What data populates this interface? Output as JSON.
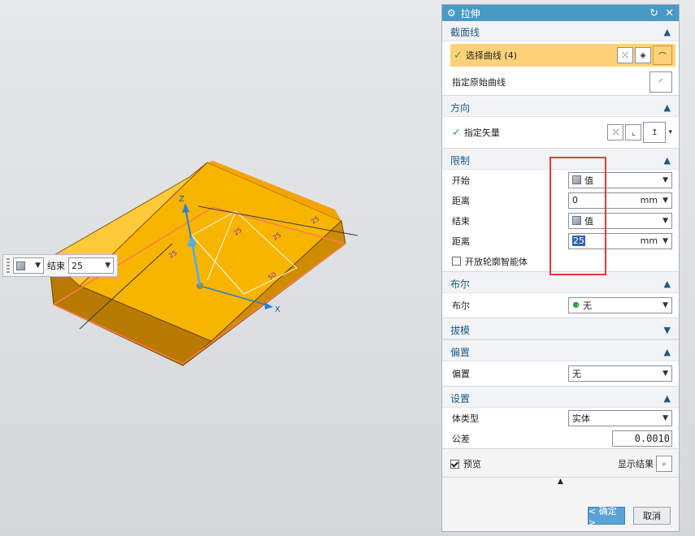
{
  "floating_bar": {
    "end_label": "结束",
    "end_value": "25"
  },
  "model": {
    "axis_z": "Z",
    "axis_x": "X",
    "dim_labels": [
      "25",
      "25",
      "25",
      "50",
      "25"
    ]
  },
  "dialog": {
    "title": "拉伸",
    "reset_glyph": "↻",
    "close_glyph": "✕",
    "sections": {
      "section_curve": {
        "title": "截面线",
        "select_curve_label": "选择曲线 (4)",
        "specify_origin_curve_label": "指定原始曲线"
      },
      "direction": {
        "title": "方向",
        "specify_vector_label": "指定矢量"
      },
      "limits": {
        "title": "限制",
        "start_label": "开始",
        "start_option": "值",
        "start_distance_label": "距离",
        "start_distance_value": "0",
        "start_unit": "mm",
        "end_label": "结束",
        "end_option": "值",
        "end_distance_label": "距离",
        "end_distance_value": "25",
        "end_unit": "mm",
        "open_profile_label": "开放轮廓智能体"
      },
      "boolean": {
        "title": "布尔",
        "label": "布尔",
        "value": "无"
      },
      "draft": {
        "title": "拔模"
      },
      "offset": {
        "title": "偏置",
        "label": "偏置",
        "value": "无"
      },
      "settings": {
        "title": "设置",
        "body_type_label": "体类型",
        "body_type_value": "实体",
        "tolerance_label": "公差",
        "tolerance_value": "0.0010"
      }
    },
    "preview_label": "预览",
    "show_result_label": "显示结果",
    "ok_label": "< 确定 >",
    "cancel_label": "取消"
  },
  "colors": {
    "title_bar": "#4a98c4",
    "section_text": "#1f5a86",
    "selection_highlight": "#ffd27a",
    "model_top": "#f7b500",
    "model_front": "#b87a00",
    "model_side": "#d99400",
    "red_annotation": "#e5393b",
    "ok_button": "#5aa2d8"
  },
  "icons": [
    "gear-icon",
    "reset-icon",
    "close-icon",
    "checkmark-icon",
    "cube-icon",
    "chevron-up-icon",
    "chevron-down-icon",
    "magnifier-icon",
    "curve-icon",
    "vector-icon"
  ]
}
